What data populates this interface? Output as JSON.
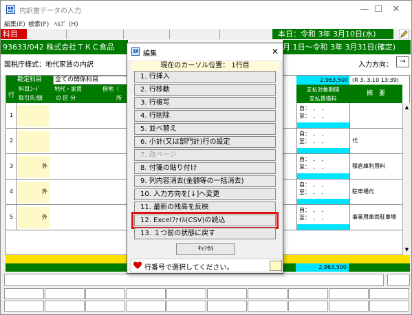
{
  "window": {
    "title": "内訳書データの入力",
    "minimize_glyph": "—",
    "maximize_glyph": "☐",
    "close_glyph": "✕"
  },
  "menubar": {
    "items": [
      "編集(E)",
      "検索(F)",
      "ﾍﾙﾌﾟ (H)"
    ]
  },
  "header": {
    "kamoku_tag": "科目",
    "today": "本日：令和 3年 3月10日(水)",
    "company": "93633/042 株式会社ＴＫＣ食品",
    "period": "月 1日〜令和 3年 3月31日(確定)"
  },
  "form": {
    "format_label": "国税庁様式：地代家賃の内訳",
    "input_direction_label": "入力方向：",
    "input_direction_value": "→"
  },
  "grid": {
    "hdr_kamoku": "勘定科目",
    "hdr_all": "全ての関係科目",
    "hdr_gyo": "行",
    "hdr_kamoku_code": "科目ｺｰﾄﾞ",
    "hdr_torihiki": "取引先|頭",
    "hdr_chidai": "地代・家賃",
    "hdr_kubun": "の 区 分",
    "hdr_shakuchi": "借地（",
    "hdr_tokoro": "所",
    "amount": "2,963,500",
    "revision": "(R 3. 3.10 13:39)",
    "hdr_shiharai1": "支払対象期間",
    "hdr_shiharai2": "支払賃借料",
    "hdr_tekiyo": "摘　要",
    "rows": [
      {
        "num": "1",
        "gai": "",
        "from": "自：　．　．",
        "to": "至：　．　．",
        "tekiyo": ""
      },
      {
        "num": "2",
        "gai": "",
        "from": "自：　．　．",
        "to": "至：　．　．",
        "tekiyo": "代"
      },
      {
        "num": "3",
        "gai": "外",
        "from": "自：　．　．",
        "to": "至：　．　．",
        "tekiyo": "積倉庫利用料"
      },
      {
        "num": "4",
        "gai": "外",
        "from": "自：　．　．",
        "to": "至：　．　．",
        "tekiyo": "駐車場代"
      },
      {
        "num": "5",
        "gai": "外",
        "from": "自：　．　．",
        "to": "至：　．　．",
        "tekiyo": "事業用車両駐車場"
      }
    ],
    "total": "2,963,500"
  },
  "dialog": {
    "title": "編集",
    "close_glyph": "✕",
    "cursor_pos": "現在のカーソル位置： 1行目",
    "items": [
      "1. 行挿入",
      "2. 行移動",
      "3. 行複写",
      "4. 行削除",
      "5. 並べ替え",
      "6. 小計(又は部門計)行の設定",
      "7. 改ページ",
      "8. 付箋の貼り付け",
      "9. 列内容消去(金額等の一括消去)",
      "10. 入力方向を[↓]へ変更",
      "11. 最新の残高を反映",
      "12. Excelﾌｧｲﾙ(CSV)の読込",
      "13. １つ前の状態に戻す"
    ],
    "disabled_index": 6,
    "selected_index": 11,
    "cancel": "ｷｬﾝｾﾙ",
    "status": "行番号で選択してください。"
  },
  "colors": {
    "green": "#007a00",
    "red": "#d40000",
    "cyan": "#00e5ff",
    "yellow": "#ffe100",
    "highlight": "#e01010"
  }
}
